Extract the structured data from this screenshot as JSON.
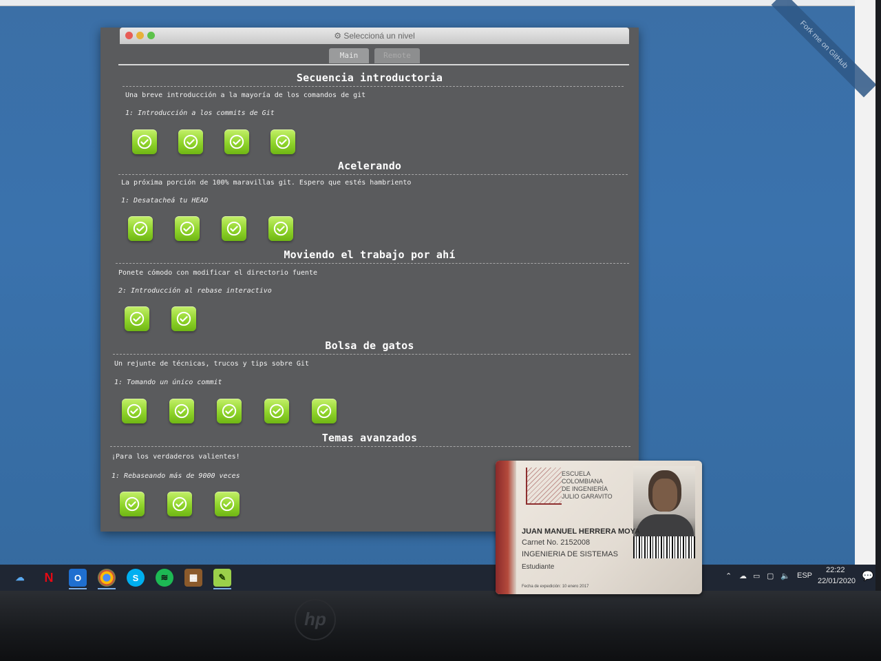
{
  "window": {
    "title": "⚙ Seleccioná un nivel",
    "tabs": [
      {
        "label": "Main",
        "active": true
      },
      {
        "label": "Remote",
        "active": false
      }
    ]
  },
  "fork_ribbon": "Fork me on GitHub",
  "sections": [
    {
      "title": "Secuencia introductoria",
      "description": "Una breve introducción a la mayoría de los comandos de git",
      "level": "1: Introducción a los commits de Git",
      "badges": 4
    },
    {
      "title": "Acelerando",
      "description": "La próxima porción de 100% maravillas git. Espero que estés hambriento",
      "level": "1: Desatacheá tu HEAD",
      "badges": 4
    },
    {
      "title": "Moviendo el trabajo por ahí",
      "description": "Ponete cómodo con modificar el directorio fuente",
      "level": "2: Introducción al rebase interactivo",
      "badges": 2
    },
    {
      "title": "Bolsa de gatos",
      "description": "Un rejunte de técnicas, trucos y tips sobre Git",
      "level": "1: Tomando un único commit",
      "badges": 5
    },
    {
      "title": "Temas avanzados",
      "description": "¡Para los verdaderos valientes!",
      "level": "1: Rebaseando más de 9000 veces",
      "badges": 3
    }
  ],
  "badge_colors": {
    "top": "#c4f06a",
    "bottom": "#6fb614"
  },
  "taskbar": {
    "apps": [
      "onedrive-icon",
      "netflix-icon",
      "outlook-icon",
      "chrome-icon",
      "skype-icon",
      "spotify-icon",
      "minecraft-icon",
      "notepad-icon"
    ],
    "language": "ESP",
    "time": "22:22",
    "date": "22/01/2020",
    "notifications": "4"
  },
  "monitor_brand": "hp",
  "id_card": {
    "school_lines": [
      "ESCUELA",
      "COLOMBIANA",
      "DE INGENIERÍA",
      "JULIO GARAVITO"
    ],
    "name": "JUAN MANUEL HERRERA MOYA",
    "carnet": "Carnet No. 2152008",
    "program": "INGENIERIA DE SISTEMAS",
    "role": "Estudiante",
    "issue_date": "Fecha de expedición: 10 enero 2017"
  }
}
